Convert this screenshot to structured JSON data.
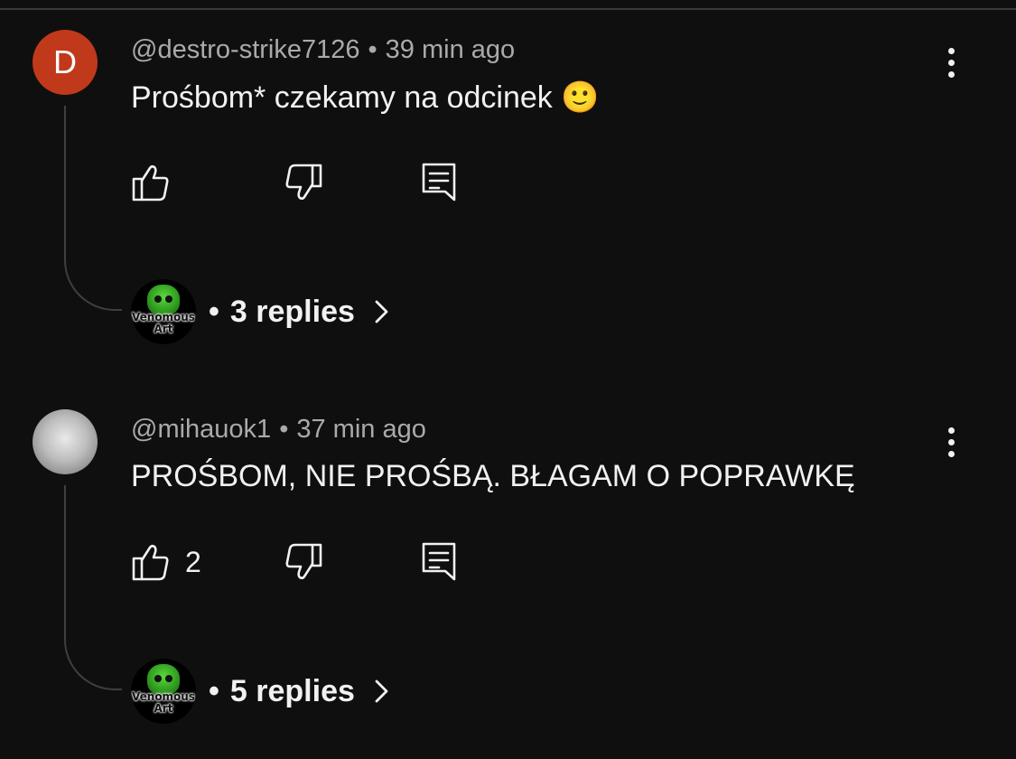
{
  "comments": [
    {
      "avatar_letter": "D",
      "avatar_color": "#c1391b",
      "author": "@destro-strike7126",
      "separator": "•",
      "time": "39 min ago",
      "text": "Prośbom* czekamy na odcinek 🙂",
      "like_count": "",
      "replies_dot": "•",
      "replies_label": "3 replies",
      "reply_avatar_brand": "Venomous Art"
    },
    {
      "avatar_letter": "",
      "avatar_color": "#bdbdbd",
      "author": "@mihauok1",
      "separator": "•",
      "time": "37 min ago",
      "text": "PROŚBOM, NIE PROŚBĄ. BŁAGAM O POPRAWKĘ",
      "like_count": "2",
      "replies_dot": "•",
      "replies_label": "5 replies",
      "reply_avatar_brand": "Venomous Art"
    }
  ],
  "icons": {
    "like": "thumbs-up-icon",
    "dislike": "thumbs-down-icon",
    "reply": "reply-comment-icon",
    "menu": "more-vert-icon",
    "chevron": "chevron-right-icon"
  },
  "colors": {
    "background": "#0f0f0f",
    "primary_text": "#f1f1f1",
    "secondary_text": "#aaaaaa"
  }
}
